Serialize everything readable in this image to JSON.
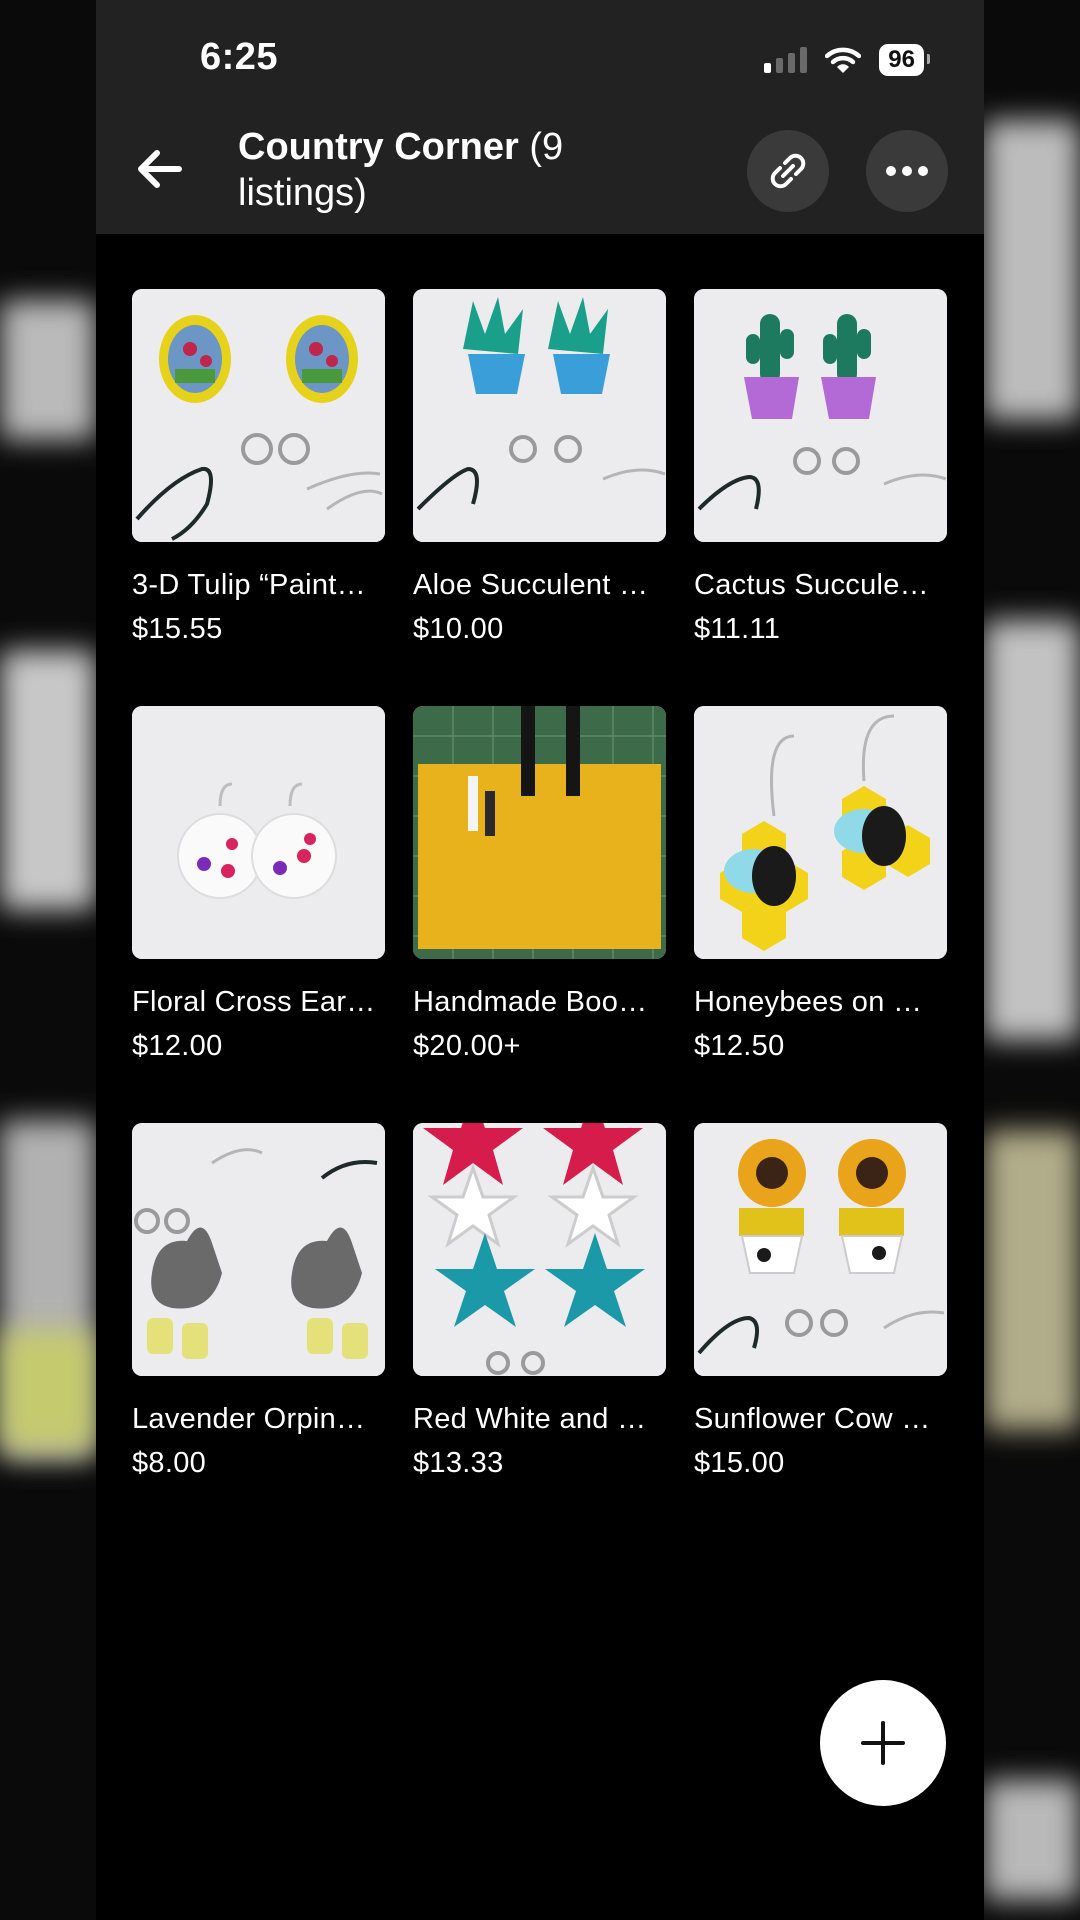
{
  "status_bar": {
    "time": "6:25",
    "battery": "96"
  },
  "header": {
    "title": "Country Corner",
    "count": "(9 listings)"
  },
  "listings": [
    {
      "name": "3-D Tulip “Paint…",
      "price": "$15.55"
    },
    {
      "name": "Aloe Succulent …",
      "price": "$10.00"
    },
    {
      "name": "Cactus Succule…",
      "price": "$11.11"
    },
    {
      "name": "Floral Cross Ear…",
      "price": "$12.00"
    },
    {
      "name": "Handmade Boo…",
      "price": "$20.00+"
    },
    {
      "name": "Honeybees on …",
      "price": "$12.50"
    },
    {
      "name": "Lavender Orpin…",
      "price": "$8.00"
    },
    {
      "name": "Red White and …",
      "price": "$13.33"
    },
    {
      "name": "Sunflower Cow …",
      "price": "$15.00"
    }
  ],
  "icons": {
    "back": "arrow-left-icon",
    "link": "link-icon",
    "more": "more-icon",
    "add": "plus-icon"
  },
  "colors": {
    "header_bg": "#222222",
    "page_bg": "#000000",
    "button_bg": "#3a3a3a"
  }
}
